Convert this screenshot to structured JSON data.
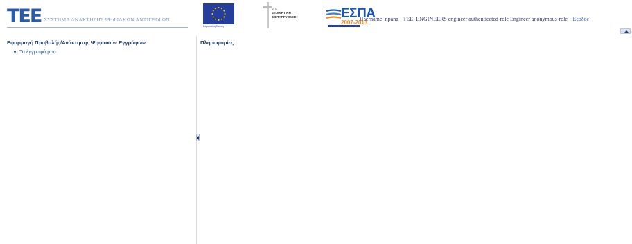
{
  "header": {
    "logo_mark": "ΤΕΕ",
    "logo_tagline": "ΣΥΣΤΗΜΑ ΑΝΑΚΤΗΣΗΣ ΨΗΦΙΑΚΩΝ ΑΝΤΙΓΡΑΦΩΝ",
    "eu_caption": "Ευρωπαϊκή Ένωση",
    "admin_small": "Ε.Π.",
    "admin_text_line1": "ΔΙΟΙΚΗΤΙΚΗ",
    "admin_text_line2": "ΜΕΤΑΡΡΥΘΜΙΣΗ",
    "espa_word": "ΕΣΠΑ",
    "espa_years": "2007-2013"
  },
  "userbar": {
    "username_label": "Username: npana",
    "roles": "TEE_ENGINEERS engineer authenticated-role Engineer anonymous-role",
    "logout": "Έξοδος"
  },
  "west": {
    "title": "Εφαρμογή Προβολής/Ανάκτησης Ψηφιακών Εγγράφων",
    "items": [
      {
        "label": "Τα έγγραφά μου"
      }
    ]
  },
  "center": {
    "title": "Πληροφορίες"
  },
  "colors": {
    "brand_blue": "#2a5ba8",
    "title_blue": "#25436e",
    "link_blue": "#2f5a9c",
    "espa_orange": "#f08a1f"
  }
}
